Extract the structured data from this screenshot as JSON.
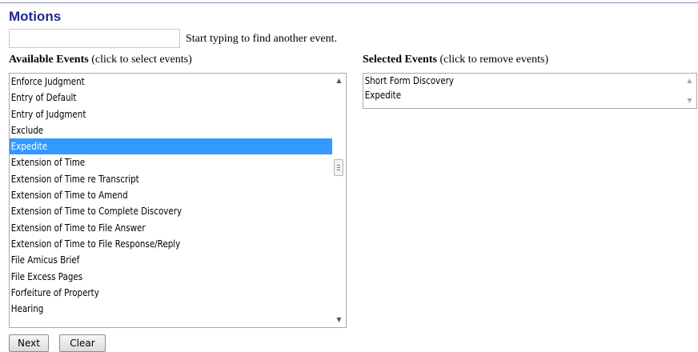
{
  "page": {
    "title": "Motions"
  },
  "search": {
    "hint": "Start typing to find another event."
  },
  "available": {
    "label_bold": "Available Events",
    "label_rest": " (click to select events)",
    "items": [
      "Enforce Judgment",
      "Entry of Default",
      "Entry of Judgment",
      "Exclude",
      "Expedite",
      "Extension of Time",
      "Extension of Time re Transcript",
      "Extension of Time to Amend",
      "Extension of Time to Complete Discovery",
      "Extension of Time to File Answer",
      "Extension of Time to File Response/Reply",
      "File Amicus Brief",
      "File Excess Pages",
      "Forfeiture of Property",
      "Hearing"
    ],
    "highlighted": "Expedite"
  },
  "selected": {
    "label_bold": "Selected Events",
    "label_rest": " (click to remove events)",
    "items": [
      "Short Form Discovery",
      "Expedite"
    ]
  },
  "buttons": {
    "next": "Next",
    "clear": "Clear"
  },
  "colors": {
    "title": "#1f2a8f",
    "highlight": "#3399ff"
  }
}
